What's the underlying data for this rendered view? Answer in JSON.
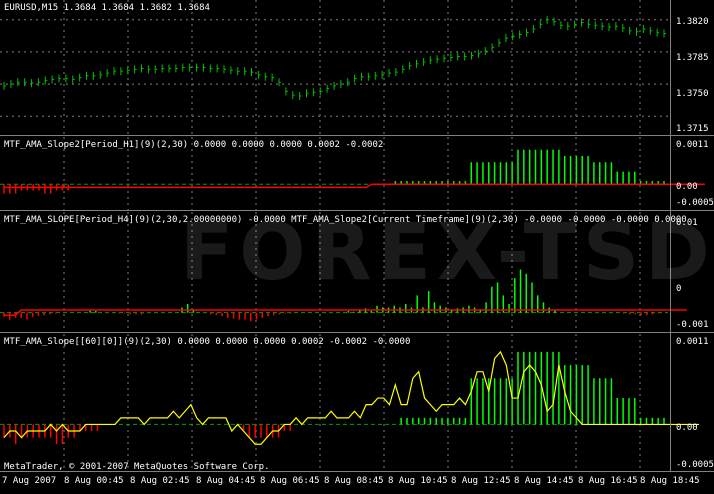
{
  "colors": {
    "background": "#000000",
    "grid": "#808080",
    "bars": "#00c000",
    "buffer_up": "#00ff00",
    "buffer_down": "#ff0000",
    "line": "#ffff00",
    "level_red": "#ff0000"
  },
  "watermark": "FOREX-TSD",
  "copyright": "MetaTrader, © 2001-2007 MetaQuotes Software Corp.",
  "panes": [
    {
      "id": "price",
      "title": "EURUSD,M15  1.3684 1.3684 1.3682 1.3684",
      "ticks": [
        "1.3820",
        "1.3785",
        "1.3750",
        "1.3715"
      ]
    },
    {
      "id": "ind1",
      "title": "MTF_AMA_Slope2[Period_H1](9)(2,30) 0.0000 0.0000 0.0000 0.0002 -0.0002",
      "ticks": [
        "0.0011",
        "0.00",
        "-0.0005"
      ]
    },
    {
      "id": "ind2",
      "title": "MTF_AMA_SLOPE[Period_H4](9)(2,30,2.00000000) -0.0000  MTF_AMA_Slope2[Current Timeframe](9)(2,30) -0.0000 -0.0000 -0.0000 0.0000",
      "ticks": [
        "0.01",
        "0",
        "-0.001"
      ]
    },
    {
      "id": "ind3",
      "title": "MTF_AMA_Slope[[60][0]](9)(2,30) 0.0000 0.0000 0.0000 0.0002 -0.0002 -0.0000",
      "ticks": [
        "0.0011",
        "0.00",
        "-0.0005"
      ]
    }
  ],
  "x_axis": [
    "7 Aug 2007",
    "8 Aug 00:45",
    "8 Aug 02:45",
    "8 Aug 04:45",
    "8 Aug 06:45",
    "8 Aug 08:45",
    "8 Aug 10:45",
    "8 Aug 12:45",
    "8 Aug 14:45",
    "8 Aug 16:45",
    "8 Aug 18:45"
  ],
  "chart_data": [
    {
      "type": "bar",
      "pane": "price",
      "ylim": [
        1.37,
        1.3835
      ],
      "close": [
        1.3748,
        1.375,
        1.3752,
        1.3752,
        1.3751,
        1.3752,
        1.3754,
        1.3755,
        1.3756,
        1.3756,
        1.3755,
        1.3757,
        1.3759,
        1.3759,
        1.376,
        1.3762,
        1.3764,
        1.3764,
        1.3765,
        1.3766,
        1.3767,
        1.3766,
        1.3766,
        1.3767,
        1.3767,
        1.3767,
        1.3768,
        1.3768,
        1.3768,
        1.3768,
        1.3767,
        1.3767,
        1.3766,
        1.3765,
        1.3764,
        1.3764,
        1.3763,
        1.376,
        1.3758,
        1.3757,
        1.3752,
        1.3742,
        1.3738,
        1.3737,
        1.374,
        1.3741,
        1.3742,
        1.3745,
        1.3748,
        1.375,
        1.3752,
        1.3756,
        1.3758,
        1.3758,
        1.3759,
        1.376,
        1.3762,
        1.3763,
        1.3766,
        1.377,
        1.3772,
        1.3774,
        1.3776,
        1.3777,
        1.3778,
        1.3779,
        1.378,
        1.378,
        1.3781,
        1.3783,
        1.3786,
        1.379,
        1.3795,
        1.38,
        1.3802,
        1.3804,
        1.3806,
        1.381,
        1.3815,
        1.382,
        1.3818,
        1.3814,
        1.3813,
        1.3815,
        1.3817,
        1.3815,
        1.3814,
        1.3813,
        1.3812,
        1.3813,
        1.3811,
        1.3808,
        1.3807,
        1.381,
        1.3808,
        1.3806,
        1.3805
      ]
    },
    {
      "type": "bar",
      "pane": "ind1",
      "ylim": [
        -0.0006,
        0.00125
      ],
      "values": [
        -0.0003,
        -0.0003,
        -0.0003,
        -0.0002,
        -0.0002,
        -0.0002,
        -0.0002,
        -0.0003,
        -0.0003,
        -0.0002,
        -0.0002,
        -0.0002,
        0,
        0,
        0,
        0,
        0,
        0,
        0,
        0,
        0,
        0,
        0,
        0,
        0,
        0,
        0,
        0,
        0,
        0,
        0,
        0,
        0,
        0,
        0,
        0,
        0,
        0,
        0,
        0,
        0,
        0,
        0,
        0,
        0,
        0,
        0,
        0,
        0,
        0,
        0,
        0,
        0,
        0,
        0,
        0,
        0,
        0,
        0,
        0,
        0,
        0,
        0,
        0,
        0,
        0,
        0,
        0.0001,
        0.0001,
        0.0001,
        0.0001,
        0.0001,
        0.0001,
        0.0001,
        0.0001,
        0.0001,
        0.0001,
        0.0001,
        0.0001,
        0.0001,
        0.0007,
        0.0007,
        0.0007,
        0.0007,
        0.0007,
        0.0007,
        0.0007,
        0.0007,
        0.0011,
        0.0011,
        0.0011,
        0.0011,
        0.0011,
        0.0011,
        0.0011,
        0.0011,
        0.0009,
        0.0009,
        0.0009,
        0.0009,
        0.0009,
        0.0007,
        0.0007,
        0.0007,
        0.0007,
        0.0004,
        0.0004,
        0.0004,
        0.0004,
        0.0001,
        0.0001,
        0.0001,
        0.0001,
        0.0001
      ],
      "red_line": [
        -0.0001,
        -0.0001,
        -0.0001,
        -0.0001,
        -0.0001,
        -0.0001,
        -0.0001,
        -0.0001,
        -0.0001,
        -0.0001,
        -0.0001,
        -0.0001,
        -0.0001,
        -0.0001,
        -0.0001,
        -0.0001,
        -0.0001,
        -0.0001,
        -0.0001,
        -0.0001,
        -0.0001,
        -0.0001,
        -0.0001,
        -0.0001,
        -0.0001,
        -0.0001,
        -0.0001,
        -0.0001,
        -0.0001,
        -0.0001,
        -0.0001,
        -0.0001,
        -0.0001,
        -0.0001,
        -0.0001,
        -0.0001,
        -0.0001,
        -0.0001,
        -0.0001,
        -0.0001,
        -0.0001,
        -0.0001,
        -0.0001,
        -0.0001,
        -0.0001,
        -0.0001,
        -0.0001,
        -0.0001,
        -0.0001,
        -0.0001,
        -0.0001,
        -0.0001,
        -0.0001,
        -0.0001,
        -0.0001,
        -0.0001,
        -0.0001,
        -0.0001,
        -0.0001,
        -0.0001,
        -0.0001,
        -0.0001,
        -0.0001,
        0,
        0,
        0,
        0,
        0,
        0,
        0,
        0,
        0,
        0,
        0,
        0,
        0,
        0,
        0,
        0,
        0,
        0,
        0,
        0,
        0,
        0,
        0,
        0,
        0,
        0,
        0,
        0,
        0,
        0,
        0,
        0,
        0,
        0,
        0,
        0,
        0,
        0,
        0,
        0,
        0,
        0,
        0,
        0,
        0,
        0,
        0,
        0,
        0,
        0,
        0,
        0,
        0,
        0,
        0,
        0,
        0,
        0
      ]
    },
    {
      "type": "bar",
      "pane": "ind2",
      "ylim": [
        -0.0012,
        0.0105
      ],
      "values": [
        -0.0005,
        -0.0008,
        -0.0006,
        -0.0006,
        -0.0008,
        -0.0005,
        -0.0004,
        -0.0003,
        -0.0002,
        -0.0001,
        0,
        0,
        0,
        0,
        0,
        0.0003,
        0.0002,
        0,
        0,
        0,
        -0.0001,
        -0.0001,
        -0.0002,
        -0.0002,
        -0.0002,
        0,
        0,
        0,
        0,
        0,
        0,
        0.0006,
        0.001,
        0.0004,
        0,
        0,
        -0.0002,
        -0.0003,
        -0.0004,
        -0.0006,
        -0.0007,
        -0.0008,
        -0.0008,
        -0.001,
        -0.0008,
        -0.0006,
        -0.0004,
        -0.0003,
        -0.0002,
        -0.0001,
        -0.0001,
        0,
        0,
        0,
        0,
        0,
        0,
        0,
        0,
        0,
        0.0002,
        0.0001,
        0.0004,
        0.0005,
        0.0002,
        0.0008,
        0.0006,
        0.0006,
        0.0008,
        0.0006,
        0.001,
        0.0006,
        0.002,
        0.0006,
        0.0025,
        0.0012,
        0.0008,
        0.0006,
        0.0004,
        0.0005,
        0.0006,
        0.0008,
        0.0006,
        0.0004,
        0.0012,
        0.003,
        0.0035,
        0.002,
        0.001,
        0.004,
        0.005,
        0.0045,
        0.0035,
        0.002,
        0.0012,
        0.0006,
        0.0003,
        0,
        0,
        0,
        0,
        0,
        0,
        0,
        0,
        0,
        0,
        0,
        -0.0001,
        -0.0002,
        -0.0002,
        -0.0003,
        -0.0003,
        -0.0002,
        -0.0001,
        0
      ],
      "red_line": [
        -0.0003,
        -0.0003,
        -0.0003,
        0.0003,
        0.0003,
        0.0003,
        0.0003,
        0.0003,
        0.0003,
        0.0003,
        0.0003,
        0.0003,
        0.0003,
        0.0003,
        0.0003,
        0.0003,
        0.0003,
        0.0003,
        0.0003,
        0.0003,
        0.0003,
        0.0003,
        0.0003,
        0.0003,
        0.0003,
        0.0003,
        0.0003,
        0.0003,
        0.0003,
        0.0003,
        0.0003,
        0.0003,
        0.0003,
        0.0003,
        0.0003,
        0.0003,
        0.0003,
        0.0003,
        0.0003,
        0.0003,
        0.0003,
        0.0003,
        0.0003,
        0.0003,
        0.0003,
        0.0003,
        0.0003,
        0.0003,
        0.0003,
        0.0003,
        0.0003,
        0.0003,
        0.0003,
        0.0003,
        0.0003,
        0.0003,
        0.0003,
        0.0003,
        0.0003,
        0.0003,
        0.0003,
        0.0003,
        0.0003,
        0.0003,
        0.0003,
        0.0003,
        0.0003,
        0.0003,
        0.0003,
        0.0003,
        0.0003,
        0.0003,
        0.0003,
        0.0003,
        0.0003,
        0.0003,
        0.0003,
        0.0003,
        0.0003,
        0.0003,
        0.0003,
        0.0003,
        0.0003,
        0.0003,
        0.0003,
        0.0003,
        0.0003,
        0.0003,
        0.0003,
        0.0003,
        0.0003,
        0.0003,
        0.0003,
        0.0003,
        0.0003,
        0.0003,
        0.0003,
        0.0003,
        0.0003,
        0.0003,
        0.0003,
        0.0003,
        0.0003,
        0.0003,
        0.0003,
        0.0003,
        0.0003,
        0.0003,
        0.0003,
        0.0003,
        0.0003,
        0.0003,
        0.0003,
        0.0003,
        0.0003,
        0.0003,
        0.0003,
        0.0003,
        0.0003,
        0.0003
      ]
    },
    {
      "type": "bar",
      "pane": "ind3",
      "ylim": [
        -0.0006,
        0.00125
      ],
      "values": [
        -0.0002,
        -0.0002,
        -0.0003,
        -0.0002,
        -0.0002,
        -0.0002,
        -0.0002,
        -0.0002,
        -0.0002,
        -0.0003,
        -0.0003,
        -0.0002,
        -0.0002,
        -0.0001,
        -0.0001,
        -0.0001,
        -0.0001,
        0,
        0,
        0,
        0,
        0,
        0,
        0,
        0,
        0,
        0,
        0,
        0,
        0,
        0,
        0,
        0,
        0,
        0,
        0,
        0,
        0,
        0,
        0,
        0,
        -0.0001,
        -0.0002,
        -0.0002,
        -0.0002,
        -0.0002,
        -0.0002,
        -0.0002,
        -0.0001,
        -0.0001,
        0,
        0,
        0,
        0,
        0,
        0,
        0,
        0,
        0,
        0,
        0,
        0,
        0,
        0,
        0,
        0,
        0,
        0,
        0.0001,
        0.0001,
        0.0001,
        0.0001,
        0.0001,
        0.0001,
        0.0001,
        0.0001,
        0.0001,
        0.0001,
        0.0001,
        0.0001,
        0.0007,
        0.0007,
        0.0007,
        0.0007,
        0.0007,
        0.0007,
        0.0007,
        0.0007,
        0.0011,
        0.0011,
        0.0011,
        0.0011,
        0.0011,
        0.0011,
        0.0011,
        0.0011,
        0.0009,
        0.0009,
        0.0009,
        0.0009,
        0.0009,
        0.0007,
        0.0007,
        0.0007,
        0.0007,
        0.0004,
        0.0004,
        0.0004,
        0.0004,
        0.0001,
        0.0001,
        0.0001,
        0.0001,
        0.0001
      ],
      "line": [
        -0.0002,
        -0.0001,
        -0.0001,
        -0.0002,
        -0.0001,
        -0.0001,
        -0.0001,
        -0.0001,
        0,
        -0.0001,
        0,
        -0.0001,
        -0.0001,
        -0.0001,
        0,
        0,
        0,
        0,
        0,
        0,
        0.0001,
        0.0001,
        0.0001,
        0.0001,
        0,
        0.0001,
        0.0001,
        0.0001,
        0.0001,
        0.0002,
        0.0001,
        0.0002,
        0.0003,
        0.0001,
        0,
        0.0001,
        0.0001,
        0.0001,
        0.0001,
        -0.0001,
        0,
        -0.0001,
        -0.0002,
        -0.0003,
        -0.0003,
        -0.0002,
        -0.0001,
        -0.0001,
        0,
        0,
        0.0001,
        0,
        0.0001,
        0.0001,
        0.0001,
        0.0001,
        0.0002,
        0.0001,
        0.0001,
        0.0001,
        0.0002,
        0.0001,
        0.0003,
        0.0003,
        0.0004,
        0.0004,
        0.0003,
        0.0006,
        0.0003,
        0.0003,
        0.0007,
        0.0008,
        0.0004,
        0.0003,
        0.0002,
        0.0003,
        0.0003,
        0.0003,
        0.0004,
        0.0003,
        0.0005,
        0.0008,
        0.0008,
        0.0005,
        0.001,
        0.0011,
        0.0009,
        0.0004,
        0.0004,
        0.0008,
        0.0009,
        0.0008,
        0.0006,
        0.0002,
        0.0003,
        0.0009,
        0.0005,
        0.0002,
        0.0001,
        0,
        0,
        0,
        0,
        0,
        0,
        0,
        0,
        0,
        0,
        0,
        0,
        0,
        0,
        0,
        0,
        0,
        0,
        0,
        0,
        0
      ]
    }
  ]
}
